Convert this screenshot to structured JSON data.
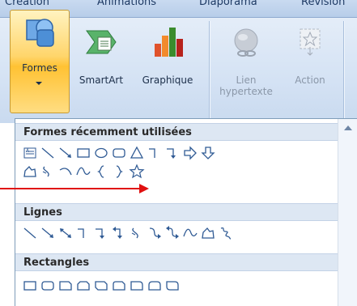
{
  "tabs": [
    {
      "label": "Création",
      "name": "tab-creation"
    },
    {
      "label": "Animations",
      "name": "tab-animations"
    },
    {
      "label": "Diaporama",
      "name": "tab-diaporama"
    },
    {
      "label": "Révision",
      "name": "tab-revision"
    }
  ],
  "ribbon": {
    "formes_label": "Formes",
    "smartart_label": "SmartArt",
    "graphique_label": "Graphique",
    "lien_label_1": "Lien",
    "lien_label_2": "hypertexte",
    "action_label": "Action"
  },
  "gallery": {
    "recent_title": "Formes récemment utilisées",
    "lignes_title": "Lignes",
    "rectangles_title": "Rectangles",
    "recent_shapes": [
      "text-box",
      "line",
      "arrow-line",
      "rectangle",
      "oval",
      "rounded-rectangle",
      "triangle",
      "elbow-connector",
      "elbow-arrow-connector",
      "right-arrow",
      "down-arrow",
      "freeform",
      "curved-connector",
      "arc",
      "curve",
      "left-brace",
      "right-brace",
      "star"
    ],
    "line_shapes": [
      "line",
      "arrow-line",
      "double-arrow-line",
      "elbow-connector",
      "elbow-arrow-connector",
      "elbow-double-arrow",
      "curved-connector",
      "curved-arrow-connector",
      "curved-double-arrow",
      "curve",
      "freeform",
      "scribble"
    ],
    "rectangle_shapes": [
      "rectangle",
      "rounded-rectangle",
      "snip-single-corner",
      "snip-same-side",
      "snip-diagonal",
      "snip-round-single",
      "round-single-corner",
      "round-same-side",
      "round-diagonal"
    ]
  },
  "colors": {
    "annotation_arrow": "#e01010",
    "shape_stroke": "#2f5a94",
    "highlight": "#ffc233"
  }
}
